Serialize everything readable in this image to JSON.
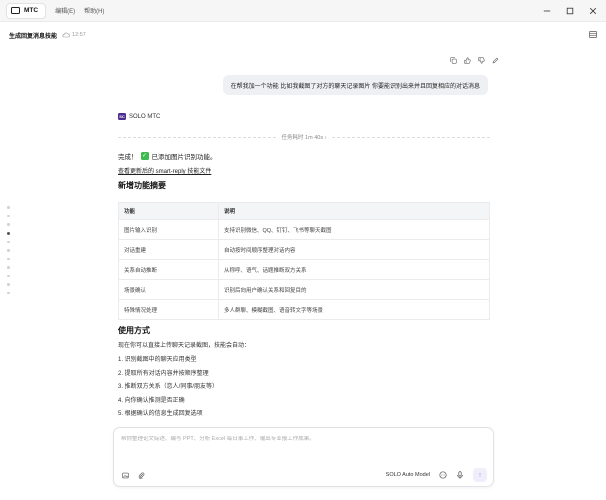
{
  "titlebar": {
    "app_tab": "MTC",
    "menu": [
      "编辑(E)",
      "帮助(H)"
    ]
  },
  "chat": {
    "title": "生成回复消息技能",
    "time": "12:57"
  },
  "user_message": "在帮我加一个功能 比如我截图了对方的聊天记录图片 你要能识别出来并且回复相应的对话消息",
  "bot": {
    "avatar": "SC",
    "name": "SOLO MTC",
    "task_duration": "任务耗时 1m 40s",
    "done_prefix": "完成！",
    "done_suffix": "已添加图片识别功能。",
    "file_link": "查看更新后的 smart-reply 技能文件",
    "features_heading": "新增功能摘要",
    "table": {
      "headers": [
        "功能",
        "说明"
      ],
      "rows": [
        [
          "图片输入识别",
          "支持识别微信、QQ、钉钉、飞书等聊天截图"
        ],
        [
          "对话重建",
          "自动按时间顺序整理对话内容"
        ],
        [
          "关系自动推断",
          "从称呼、语气、话题推断双方关系"
        ],
        [
          "场景确认",
          "识别后向用户确认关系和回复目的"
        ],
        [
          "特殊情况处理",
          "多人群聊、模糊截图、语音转文字等场景"
        ]
      ]
    },
    "usage_heading": "使用方式",
    "usage_intro": "现在你可以直接上传聊天记录截图，技能会自动：",
    "steps": [
      "1. 识别截图中的聊天应用类型",
      "2. 提取所有对话内容并按顺序整理",
      "3. 推断双方关系（恋人/同事/朋友等）",
      "4. 向你确认推测是否正确",
      "5. 根据确认的信息生成回复选项"
    ]
  },
  "composer": {
    "placeholder": "帮你整理论文综述、编写 PPT、分析 Excel 每日事工作、输出专业报工作成果。",
    "model": "SOLO Auto Model"
  },
  "colors": {
    "accent_check": "#3dbb4e",
    "avatar_bg": "#4b2d8f",
    "user_bubble": "#eef0f3",
    "send_button": "#f1eefb"
  }
}
